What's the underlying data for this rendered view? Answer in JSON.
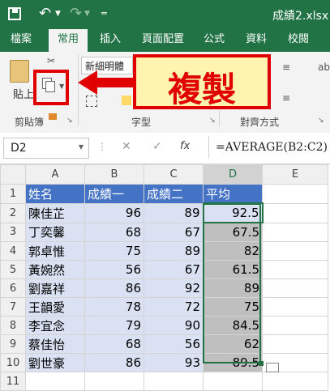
{
  "window": {
    "title": "成績2.xlsx"
  },
  "tabs": [
    {
      "label": "檔案"
    },
    {
      "label": "常用"
    },
    {
      "label": "插入"
    },
    {
      "label": "頁面配置"
    },
    {
      "label": "公式"
    },
    {
      "label": "資料"
    },
    {
      "label": "校閱"
    }
  ],
  "ribbon": {
    "paste_label": "貼上",
    "font_name": "新細明體",
    "clipboard_group": "剪貼簿",
    "font_group": "字型",
    "align_group": "對齊方式",
    "callout": "複製"
  },
  "formula_bar": {
    "name_box": "D2",
    "cancel": "✕",
    "enter": "✓",
    "fx": "fx",
    "formula": "=AVERAGE(B2:C2)"
  },
  "sheet": {
    "columns": [
      "A",
      "B",
      "C",
      "D",
      "E"
    ],
    "rows": [
      "1",
      "2",
      "3",
      "4",
      "5",
      "6",
      "7",
      "8",
      "9",
      "10",
      "11"
    ],
    "headers": [
      "姓名",
      "成績一",
      "成績二",
      "平均"
    ],
    "data": [
      [
        "陳佳芷",
        "96",
        "89",
        "92.5"
      ],
      [
        "丁奕馨",
        "68",
        "67",
        "67.5"
      ],
      [
        "郭卓惟",
        "75",
        "89",
        "82"
      ],
      [
        "黃婉然",
        "56",
        "67",
        "61.5"
      ],
      [
        "劉嘉祥",
        "86",
        "92",
        "89"
      ],
      [
        "王韻愛",
        "78",
        "72",
        "75"
      ],
      [
        "李宜念",
        "79",
        "90",
        "84.5"
      ],
      [
        "蔡佳怡",
        "68",
        "56",
        "62"
      ],
      [
        "劉世豪",
        "86",
        "93",
        "89.5"
      ]
    ]
  },
  "colors": {
    "excel_green": "#217346",
    "header_blue": "#4472c4",
    "row_blue": "#d9e1f2",
    "callout_red": "#e00000",
    "callout_fill": "#fff3b0"
  }
}
